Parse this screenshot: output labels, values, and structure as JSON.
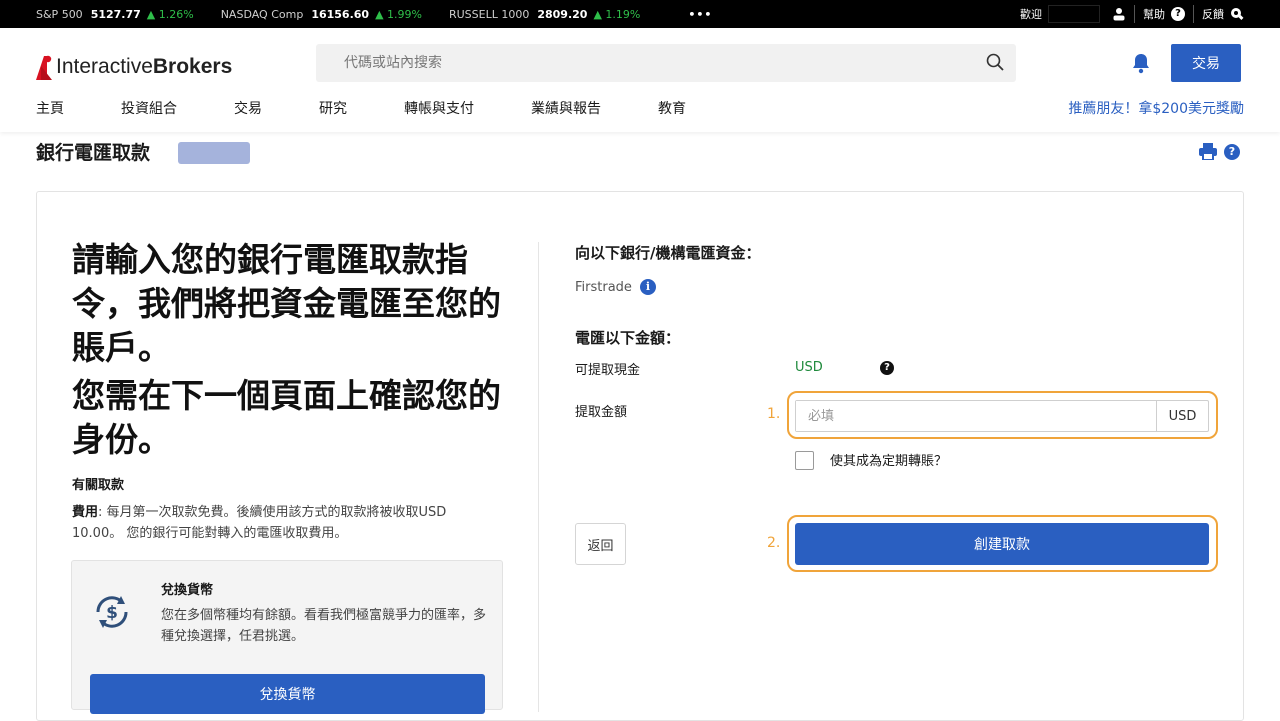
{
  "ticker": {
    "items": [
      {
        "name": "S&P 500",
        "value": "5127.77",
        "change": "▲ 1.26%"
      },
      {
        "name": "NASDAQ Comp",
        "value": "16156.60",
        "change": "▲ 1.99%"
      },
      {
        "name": "RUSSELL 1000",
        "value": "2809.20",
        "change": "▲ 1.19%"
      }
    ],
    "more": "•••",
    "welcome": "歡迎",
    "help": "幫助",
    "feedback": "反饋"
  },
  "header": {
    "logo_a": "Interactive",
    "logo_b": "Brokers",
    "search_placeholder": "代碼或站內搜索",
    "trade_label": "交易",
    "nav": [
      "主頁",
      "投資組合",
      "交易",
      "研究",
      "轉帳與支付",
      "業績與報告",
      "教育"
    ],
    "refer": "推薦朋友！拿$200美元獎勵"
  },
  "page": {
    "title": "銀行電匯取款"
  },
  "left": {
    "headline1": "請輸入您的銀行電匯取款指令，我們將把資金電匯至您的賬戶。",
    "headline2": "您需在下一個頁面上確認您的身份。",
    "about_title": "有關取款",
    "fee_label": "費用",
    "fee_text": ": 每月第一次取款免費。後續使用該方式的取款將被收取USD 10.00。 您的銀行可能對轉入的電匯收取費用。",
    "fx_title": "兌換貨幣",
    "fx_text": "您在多個幣種均有餘額。看看我們極富競爭力的匯率，多種兌換選擇，任君挑選。",
    "fx_button": "兌換貨幣"
  },
  "right": {
    "dest_title": "向以下銀行/機構電匯資金：",
    "bank_name": "Firstrade",
    "amount_title": "電匯以下金額：",
    "available_label": "可提取現金",
    "available_value": "USD",
    "withdraw_label": "提取金額",
    "step1": "1.",
    "amount_placeholder": "必填",
    "amount_currency": "USD",
    "recurring_label": "使其成為定期轉賬？",
    "back_button": "返回",
    "step2": "2.",
    "create_button": "創建取款"
  },
  "colors": {
    "accent": "#2a5fc1",
    "highlight": "#f0a43a",
    "positive": "#1f8a3c"
  }
}
